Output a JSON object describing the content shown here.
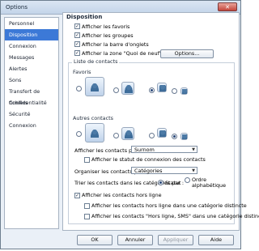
{
  "window": {
    "title": "Options",
    "close_icon": "close-icon"
  },
  "sidebar": {
    "items": [
      {
        "label": "Personnel",
        "active": false
      },
      {
        "label": "Disposition",
        "active": true
      },
      {
        "label": "Connexion",
        "active": false
      },
      {
        "label": "Messages",
        "active": false
      },
      {
        "label": "Alertes",
        "active": false
      },
      {
        "label": "Sons",
        "active": false
      },
      {
        "label": "Transfert de fichiers",
        "active": false
      },
      {
        "label": "Confidentialité",
        "active": false
      },
      {
        "label": "Sécurité",
        "active": false
      },
      {
        "label": "Connexion",
        "active": false
      }
    ]
  },
  "main": {
    "title": "Disposition",
    "checkboxes": [
      {
        "label": "Afficher les favoris",
        "checked": true
      },
      {
        "label": "Afficher les groupes",
        "checked": true
      },
      {
        "label": "Afficher la barre d'onglets",
        "checked": true
      },
      {
        "label": "Afficher la zone \"Quoi de neuf\"",
        "checked": true
      }
    ],
    "options_button": "Options...",
    "contact_list_group": "Liste de contacts",
    "favorites_label": "Favoris",
    "others_label": "Autres contacts",
    "show_contacts_label": "Afficher les contacts par :",
    "show_contacts_value": "Surnom",
    "show_status_label": "Afficher le statut de connexion des contacts",
    "organize_label": "Organiser les contacts par :",
    "organize_value": "Catégories",
    "sort_label": "Trier les contacts dans les catégories par :",
    "sort_status": "Statut",
    "sort_alpha": "Ordre alphabétique",
    "offline_contacts": "Afficher les contacts hors ligne",
    "offline_cat": "Afficher les contacts hors ligne dans une catégorie distincte",
    "sms_cat": "Afficher les contacts \"Hors ligne, SMS\" dans une catégorie distincte"
  },
  "footer": {
    "ok": "OK",
    "cancel": "Annuler",
    "apply": "Appliquer",
    "help": "Aide"
  }
}
